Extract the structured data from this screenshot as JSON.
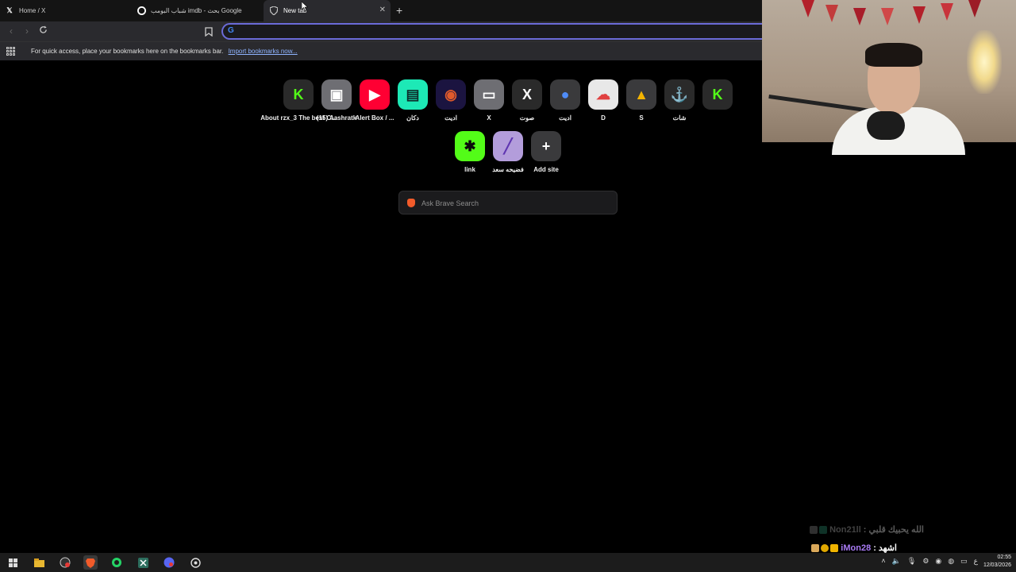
{
  "tabs": [
    {
      "title": "Home / X",
      "icon": "x-logo-icon",
      "active": false
    },
    {
      "title": "شباب البومب imdb - بحث Google",
      "icon": "google-icon",
      "active": false
    },
    {
      "title": "New tab",
      "icon": "brave-shield-icon",
      "active": true
    }
  ],
  "omnibox": {
    "value": "",
    "icon": "google-icon"
  },
  "bookmarks_bar": {
    "hint": "For quick access, place your bookmarks here on the bookmarks bar.",
    "import_link": "Import bookmarks now..."
  },
  "top_sites": [
    {
      "label": "About rzx_3 The best C...",
      "glyph": "K",
      "bg": "#2a2a2a",
      "fg": "#53fc18"
    },
    {
      "label": "(15) Aashratk",
      "glyph": "▣",
      "bg": "#6e6e73",
      "fg": "#ffffff"
    },
    {
      "label": "Alert Box / ...",
      "glyph": "▶",
      "bg": "#ff0033",
      "fg": "#ffffff"
    },
    {
      "label": "دكان",
      "glyph": "▤",
      "bg": "#1de9b6",
      "fg": "#0d2b2a"
    },
    {
      "label": "اديت",
      "glyph": "◉",
      "bg": "#1b1440",
      "fg": "#e05a2b"
    },
    {
      "label": "X",
      "glyph": "▭",
      "bg": "#6e6e73",
      "fg": "#ffffff"
    },
    {
      "label": "صوت",
      "glyph": "X",
      "bg": "#2a2a2a",
      "fg": "#ffffff"
    },
    {
      "label": "اديت",
      "glyph": "●",
      "bg": "#3a3a3c",
      "fg": "#4f8cf7"
    },
    {
      "label": "D",
      "glyph": "☁",
      "bg": "#e8e8e8",
      "fg": "#e04040"
    },
    {
      "label": "S",
      "glyph": "▲",
      "bg": "#3a3a3c",
      "fg": "#f4b400"
    },
    {
      "label": "شات",
      "glyph": "⚓",
      "bg": "#2a2a2a",
      "fg": "#ffffff"
    },
    {
      "label": "",
      "glyph": "K",
      "bg": "#2a2a2a",
      "fg": "#53fc18"
    }
  ],
  "top_sites_row2": [
    {
      "label": "link",
      "glyph": "✱",
      "bg": "#53fc18",
      "fg": "#0c0c0c"
    },
    {
      "label": "فضيحه سعد",
      "glyph": "╱",
      "bg": "#b39ddb",
      "fg": "#5e35b1"
    },
    {
      "label": "Add site",
      "glyph": "+",
      "bg": "#3a3a3c",
      "fg": "#ffffff"
    }
  ],
  "search": {
    "placeholder": "Ask Brave Search"
  },
  "chat": [
    {
      "user": "Non21ll",
      "message": "الله يحبيك قلبي",
      "faded": true
    },
    {
      "user": "iMon28",
      "message": "اشهد",
      "faded": false
    },
    {
      "user": "iMon28",
      "message": "",
      "faded": false
    }
  ],
  "taskbar": {
    "apps": [
      "windows-start-icon",
      "file-explorer-icon",
      "obs-icon",
      "brave-icon",
      "whatsapp-icon",
      "capcut-icon",
      "discord-icon",
      "steam-icon"
    ],
    "tray_lang": "ع",
    "time": "02:55",
    "date": "12/03/2026"
  }
}
